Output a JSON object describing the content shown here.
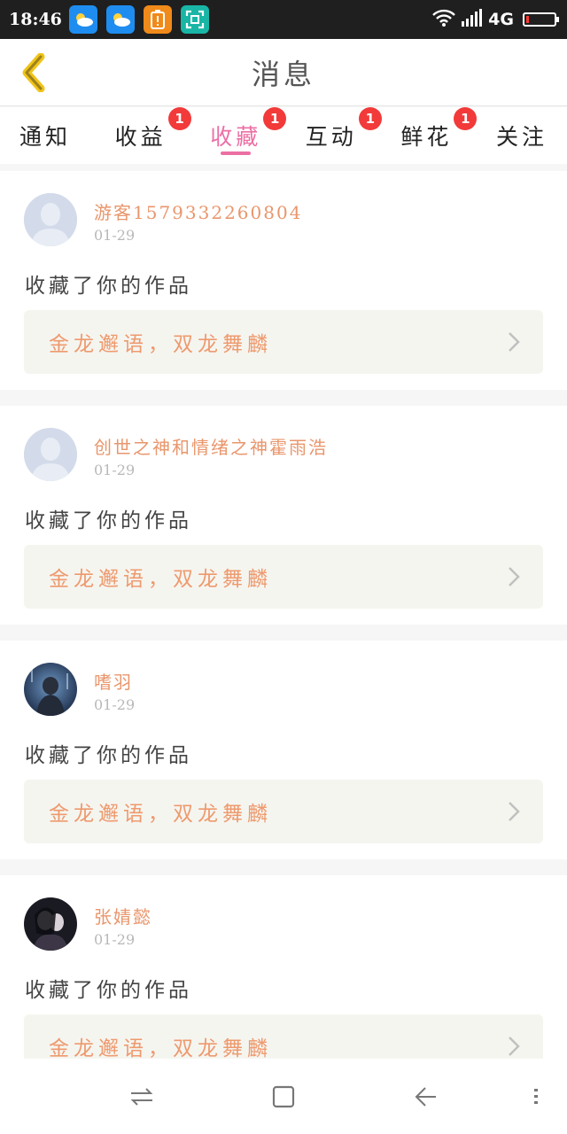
{
  "status_bar": {
    "time": "18:46",
    "network": "4G",
    "icons": [
      "weather-icon",
      "weather-icon",
      "battery-saver-icon",
      "screenshot-icon",
      "wifi-icon",
      "signal-icon",
      "battery-icon"
    ],
    "battery_level": 0.08
  },
  "header": {
    "title": "消息"
  },
  "tabs": [
    {
      "label": "通知",
      "badge": ""
    },
    {
      "label": "收益",
      "badge": "1"
    },
    {
      "label": "收藏",
      "badge": "1",
      "active": true
    },
    {
      "label": "互动",
      "badge": "1"
    },
    {
      "label": "鲜花",
      "badge": "1"
    },
    {
      "label": "关注",
      "badge": ""
    }
  ],
  "feed": [
    {
      "user": "游客1579332260804",
      "date": "01-29",
      "action": "收藏了你的作品",
      "work": "金龙邂语，双龙舞麟",
      "avatar": "default"
    },
    {
      "user": "创世之神和情绪之神霍雨浩",
      "date": "01-29",
      "action": "收藏了你的作品",
      "work": "金龙邂语，双龙舞麟",
      "avatar": "default"
    },
    {
      "user": "嗜羽",
      "date": "01-29",
      "action": "收藏了你的作品",
      "work": "金龙邂语，双龙舞麟",
      "avatar": "photo-blue"
    },
    {
      "user": "张婧懿",
      "date": "01-29",
      "action": "收藏了你的作品",
      "work": "金龙邂语，双龙舞麟",
      "avatar": "photo-dark"
    }
  ],
  "colors": {
    "accent": "#ec6fa4",
    "name": "#e9966c",
    "badge": "#f23a3a",
    "back_arrow": "#f0c419"
  }
}
